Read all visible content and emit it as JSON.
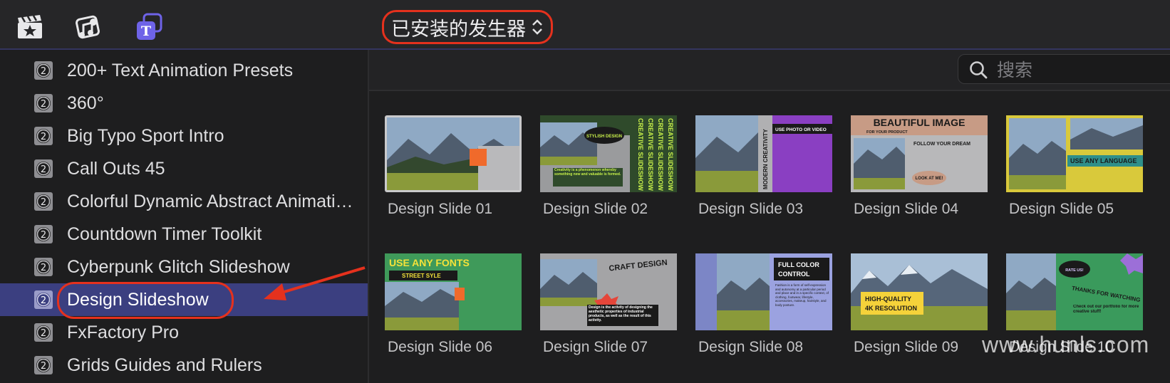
{
  "toolbar": {
    "buttons": [
      {
        "name": "media-browser-button",
        "icon": "clapperboard-star-icon"
      },
      {
        "name": "audio-browser-button",
        "icon": "music-photo-icon"
      },
      {
        "name": "titles-browser-button",
        "icon": "titles-generators-icon",
        "active_color": "#6e63e8"
      }
    ],
    "dropdown_label": "已安装的发生器"
  },
  "sidebar": {
    "items": [
      {
        "label": "200+ Text Animation Presets"
      },
      {
        "label": "360°"
      },
      {
        "label": "Big Typo Sport Intro"
      },
      {
        "label": "Call Outs 45"
      },
      {
        "label": "Colorful Dynamic Abstract Animations"
      },
      {
        "label": "Countdown Timer Toolkit"
      },
      {
        "label": "Cyberpunk Glitch Slideshow"
      },
      {
        "label": "Design Slideshow",
        "selected": true
      },
      {
        "label": "FxFactory Pro"
      },
      {
        "label": "Grids Guides and Rulers"
      }
    ],
    "selected_color": "#3b3f80",
    "annotation_color": "#e5311d"
  },
  "search": {
    "placeholder": "搜索"
  },
  "grid": {
    "tiles": [
      {
        "label": "Design Slide 01",
        "selected": true,
        "theme": "#f06a2b",
        "texts": []
      },
      {
        "label": "Design Slide 02",
        "theme": "#2f4a2b",
        "texts": [
          "STYLISH DESIGN",
          "CREATIVE SLIDESHOW",
          "Creativity is a phenomenon whereby something new and valuable is formed."
        ]
      },
      {
        "label": "Design Slide 03",
        "theme": "#8a3fc2",
        "texts": [
          "USE PHOTO OR VIDEO",
          "MODERN CREATIVITY"
        ]
      },
      {
        "label": "Design Slide 04",
        "theme": "#c79b85",
        "texts": [
          "BEAUTIFUL IMAGE",
          "FOR YOUR PRODUCT",
          "FOLLOW YOUR DREAM",
          "LOOK AT ME!"
        ]
      },
      {
        "label": "Design Slide 05",
        "theme": "#d9c93b",
        "texts": [
          "USE ANY LANGUAGE"
        ]
      },
      {
        "label": "Design Slide 06",
        "theme": "#3f9a5a",
        "texts": [
          "USE ANY FONTS",
          "STREET SYLE"
        ]
      },
      {
        "label": "Design Slide 07",
        "theme": "#9a9a9a",
        "texts": [
          "CRAFT DESIGN",
          "Design is the activity of designing the aesthetic properties of industrial products, as well as the result of this activity."
        ]
      },
      {
        "label": "Design Slide 08",
        "theme": "#9ba2e0",
        "texts": [
          "FULL COLOR",
          "CONTROL",
          "Fashion is a form of self-expression and autonomy at a particular period and place and in a specific context, of clothing, footwear, lifestyle, accessories, makeup, hairstyle, and body posture."
        ]
      },
      {
        "label": "Design Slide 09",
        "theme": "#f5d23a",
        "texts": [
          "HIGH-QUALITY",
          "4K RESOLUTION"
        ]
      },
      {
        "label": "Design Slide 10",
        "theme": "#3a9a5c",
        "texts": [
          "RATE US!",
          "THANKS FOR WATCHING",
          "Check out our portfolio for more creative stuff!"
        ]
      }
    ]
  },
  "watermark": "www.hunls.com"
}
